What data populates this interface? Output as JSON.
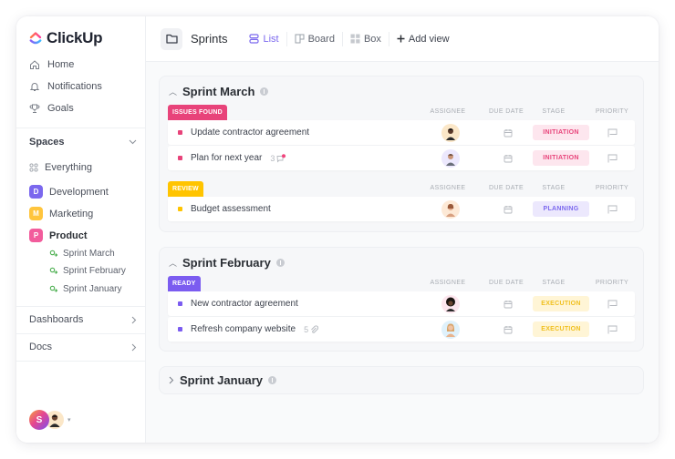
{
  "brand": {
    "name": "ClickUp"
  },
  "sidebar": {
    "nav": [
      {
        "label": "Home",
        "icon": "home-icon"
      },
      {
        "label": "Notifications",
        "icon": "bell-icon"
      },
      {
        "label": "Goals",
        "icon": "trophy-icon"
      }
    ],
    "spaces_label": "Spaces",
    "everything_label": "Everything",
    "spaces": [
      {
        "badge": "D",
        "label": "Development",
        "color": "#7b68ee"
      },
      {
        "badge": "M",
        "label": "Marketing",
        "color": "#ffc53d"
      },
      {
        "badge": "P",
        "label": "Product",
        "color": "#f25c9c"
      }
    ],
    "product_lists": [
      {
        "label": "Sprint  March"
      },
      {
        "label": "Sprint  February"
      },
      {
        "label": "Sprint January"
      }
    ],
    "dashboards_label": "Dashboards",
    "docs_label": "Docs",
    "user_avatar_initial": "S"
  },
  "header": {
    "title": "Sprints",
    "views": [
      {
        "label": "List",
        "active": true
      },
      {
        "label": "Board",
        "active": false
      },
      {
        "label": "Box",
        "active": false
      }
    ],
    "add_view_label": "Add view"
  },
  "columns": {
    "assignee": "ASSIGNEE",
    "due_date": "DUE DATE",
    "stage": "STAGE",
    "priority": "PRIORITY"
  },
  "sprints": [
    {
      "title": "Sprint March",
      "expanded": true,
      "groups": [
        {
          "status": "ISSUES FOUND",
          "color": "#e8437a",
          "tasks": [
            {
              "name": "Update contractor agreement",
              "meta": "",
              "stage": "INITIATION"
            },
            {
              "name": "Plan for next year",
              "meta": "3",
              "meta_icon": "comment-icon",
              "stage": "INITIATION"
            }
          ]
        },
        {
          "status": "REVIEW",
          "color": "#ffc400",
          "tasks": [
            {
              "name": "Budget assessment",
              "meta": "",
              "stage": "PLANNING"
            }
          ]
        }
      ]
    },
    {
      "title": "Sprint February",
      "expanded": true,
      "groups": [
        {
          "status": "READY",
          "color": "#7b5cf0",
          "tasks": [
            {
              "name": "New contractor agreement",
              "meta": "",
              "stage": "EXECUTION"
            },
            {
              "name": "Refresh company website",
              "meta": "5",
              "meta_icon": "paperclip-icon",
              "stage": "EXECUTION"
            }
          ]
        }
      ]
    },
    {
      "title": "Sprint January",
      "expanded": false
    }
  ],
  "stage_colors": {
    "INITIATION": {
      "bg": "#fde6ee",
      "fg": "#e8437a"
    },
    "PLANNING": {
      "bg": "#ece8fd",
      "fg": "#7b68ee"
    },
    "EXECUTION": {
      "bg": "#fff5d6",
      "fg": "#f0c020"
    }
  }
}
